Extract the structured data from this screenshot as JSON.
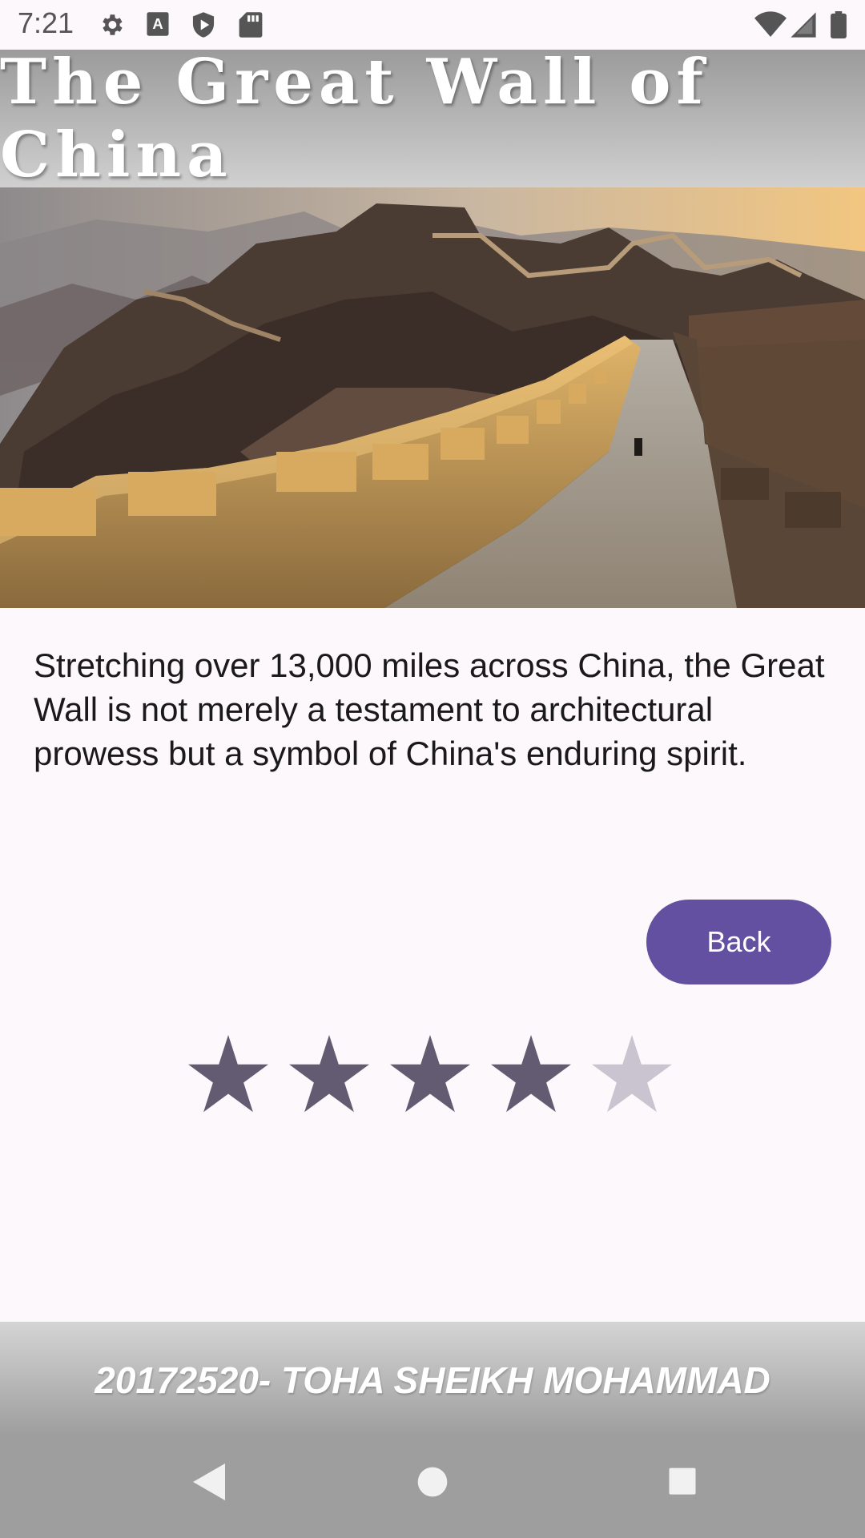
{
  "status_bar": {
    "time": "7:21",
    "left_icons": [
      "gear-icon",
      "a-keyboard-icon",
      "play-protect-icon",
      "sd-card-icon"
    ],
    "right_icons": [
      "wifi-icon",
      "signal-icon",
      "battery-icon"
    ]
  },
  "header": {
    "title": "The Great Wall of China"
  },
  "hero": {
    "image": "great-wall-photo"
  },
  "description": "Stretching over 13,000 miles across China, the Great Wall is not merely a testament to architectural prowess but a symbol of China's enduring spirit.",
  "back_button": {
    "label": "Back"
  },
  "rating": {
    "value": 4.5,
    "max": 5,
    "filled_color": "#625b71",
    "empty_color": "#cac4d0"
  },
  "footer": {
    "text": "20172520- TOHA SHEIKH MOHAMMAD"
  },
  "nav_bar": {
    "buttons": [
      "back-triangle-icon",
      "home-circle-icon",
      "recents-square-icon"
    ]
  },
  "colors": {
    "accent": "#6350a0",
    "background": "#fdf8fb"
  }
}
